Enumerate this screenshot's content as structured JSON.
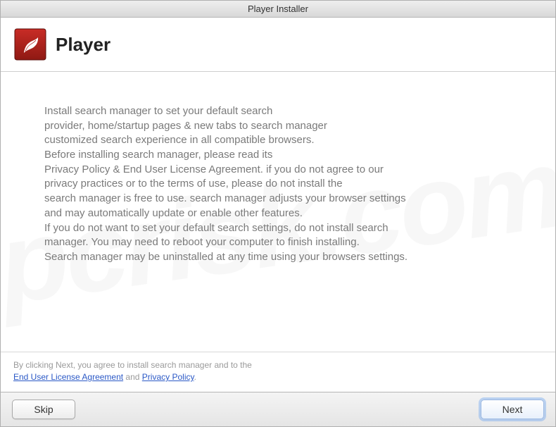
{
  "titlebar": "Player Installer",
  "header": {
    "app_name": "Player"
  },
  "body": {
    "line1": "Install search manager to set your default search",
    "line2": "provider, home/startup pages & new tabs to search manager",
    "line3": "customized search experience in all compatible browsers.",
    "line4": "Before installing search manager, please read its",
    "line5": "Privacy Policy & End User License Agreement. if you do not agree to our",
    "line6": "privacy practices or to the terms of use, please do not install the",
    "line7": "search manager is free to use. search manager adjusts your browser settings",
    "line8": "and may automatically update or enable other features.",
    "line9": "If you do not want to set your default search settings, do not install search",
    "line10": "manager. You may need to reboot your computer to finish installing.",
    "line11": "Search manager may be uninstalled at any time using your browsers settings."
  },
  "footer": {
    "text_prefix": "By clicking Next, you agree to install search manager and to the",
    "eula_label": "End User License Agreement",
    "and": " and ",
    "privacy_label": "Privacy Policy",
    "period": "."
  },
  "buttons": {
    "skip": "Skip",
    "next": "Next"
  },
  "watermark": "pcrisk.com"
}
